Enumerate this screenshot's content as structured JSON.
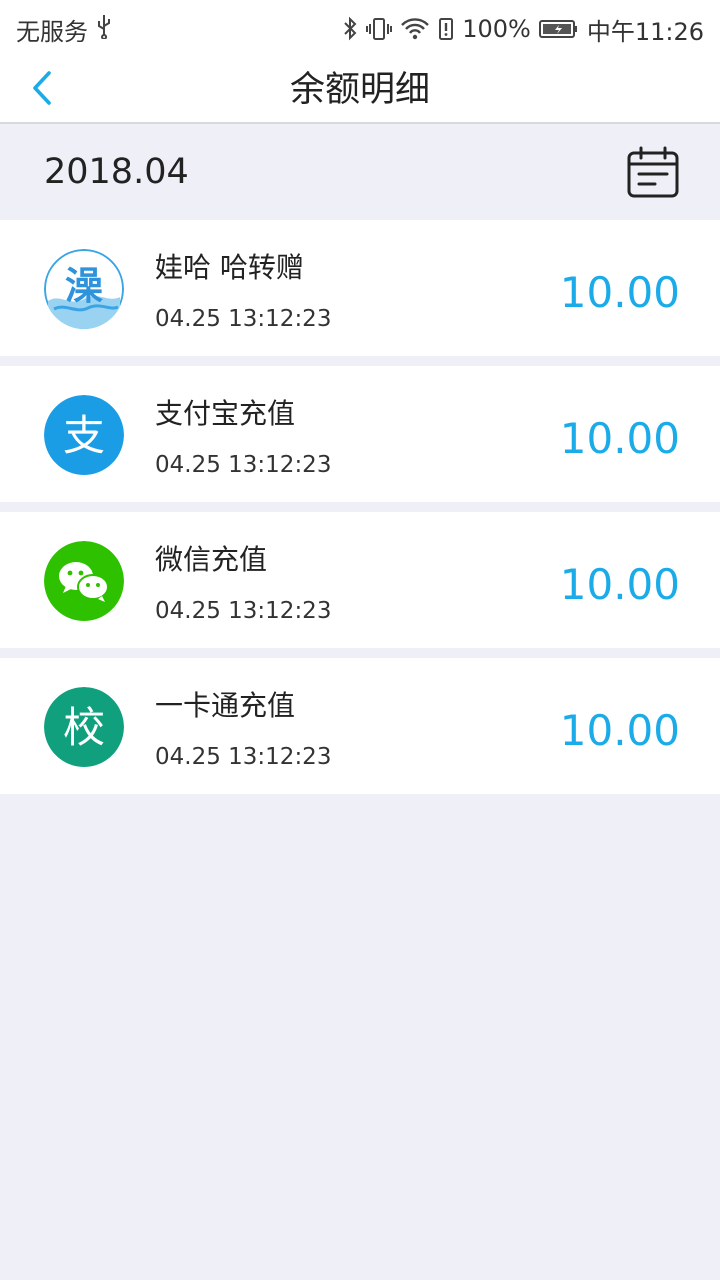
{
  "status": {
    "carrier": "无服务",
    "battery_percent": "100%",
    "time": "中午11:26"
  },
  "nav": {
    "title": "余额明细"
  },
  "month": {
    "label": "2018.04"
  },
  "transactions": [
    {
      "title": "娃哈 哈转赠",
      "time": "04.25 13:12:23",
      "amount": "10.00",
      "icon": "bath-icon",
      "icon_char": "澡"
    },
    {
      "title": "支付宝充值",
      "time": "04.25 13:12:23",
      "amount": "10.00",
      "icon": "alipay-icon",
      "icon_char": "支"
    },
    {
      "title": "微信充值",
      "time": "04.25 13:12:23",
      "amount": "10.00",
      "icon": "wechat-icon"
    },
    {
      "title": "一卡通充值",
      "time": "04.25 13:12:23",
      "amount": "10.00",
      "icon": "campus-card-icon",
      "icon_char": "校"
    }
  ],
  "colors": {
    "accent": "#1aabe8",
    "alipay": "#1b9de5",
    "wechat": "#2dc100",
    "campus": "#10a07e",
    "background": "#eff0f7"
  }
}
